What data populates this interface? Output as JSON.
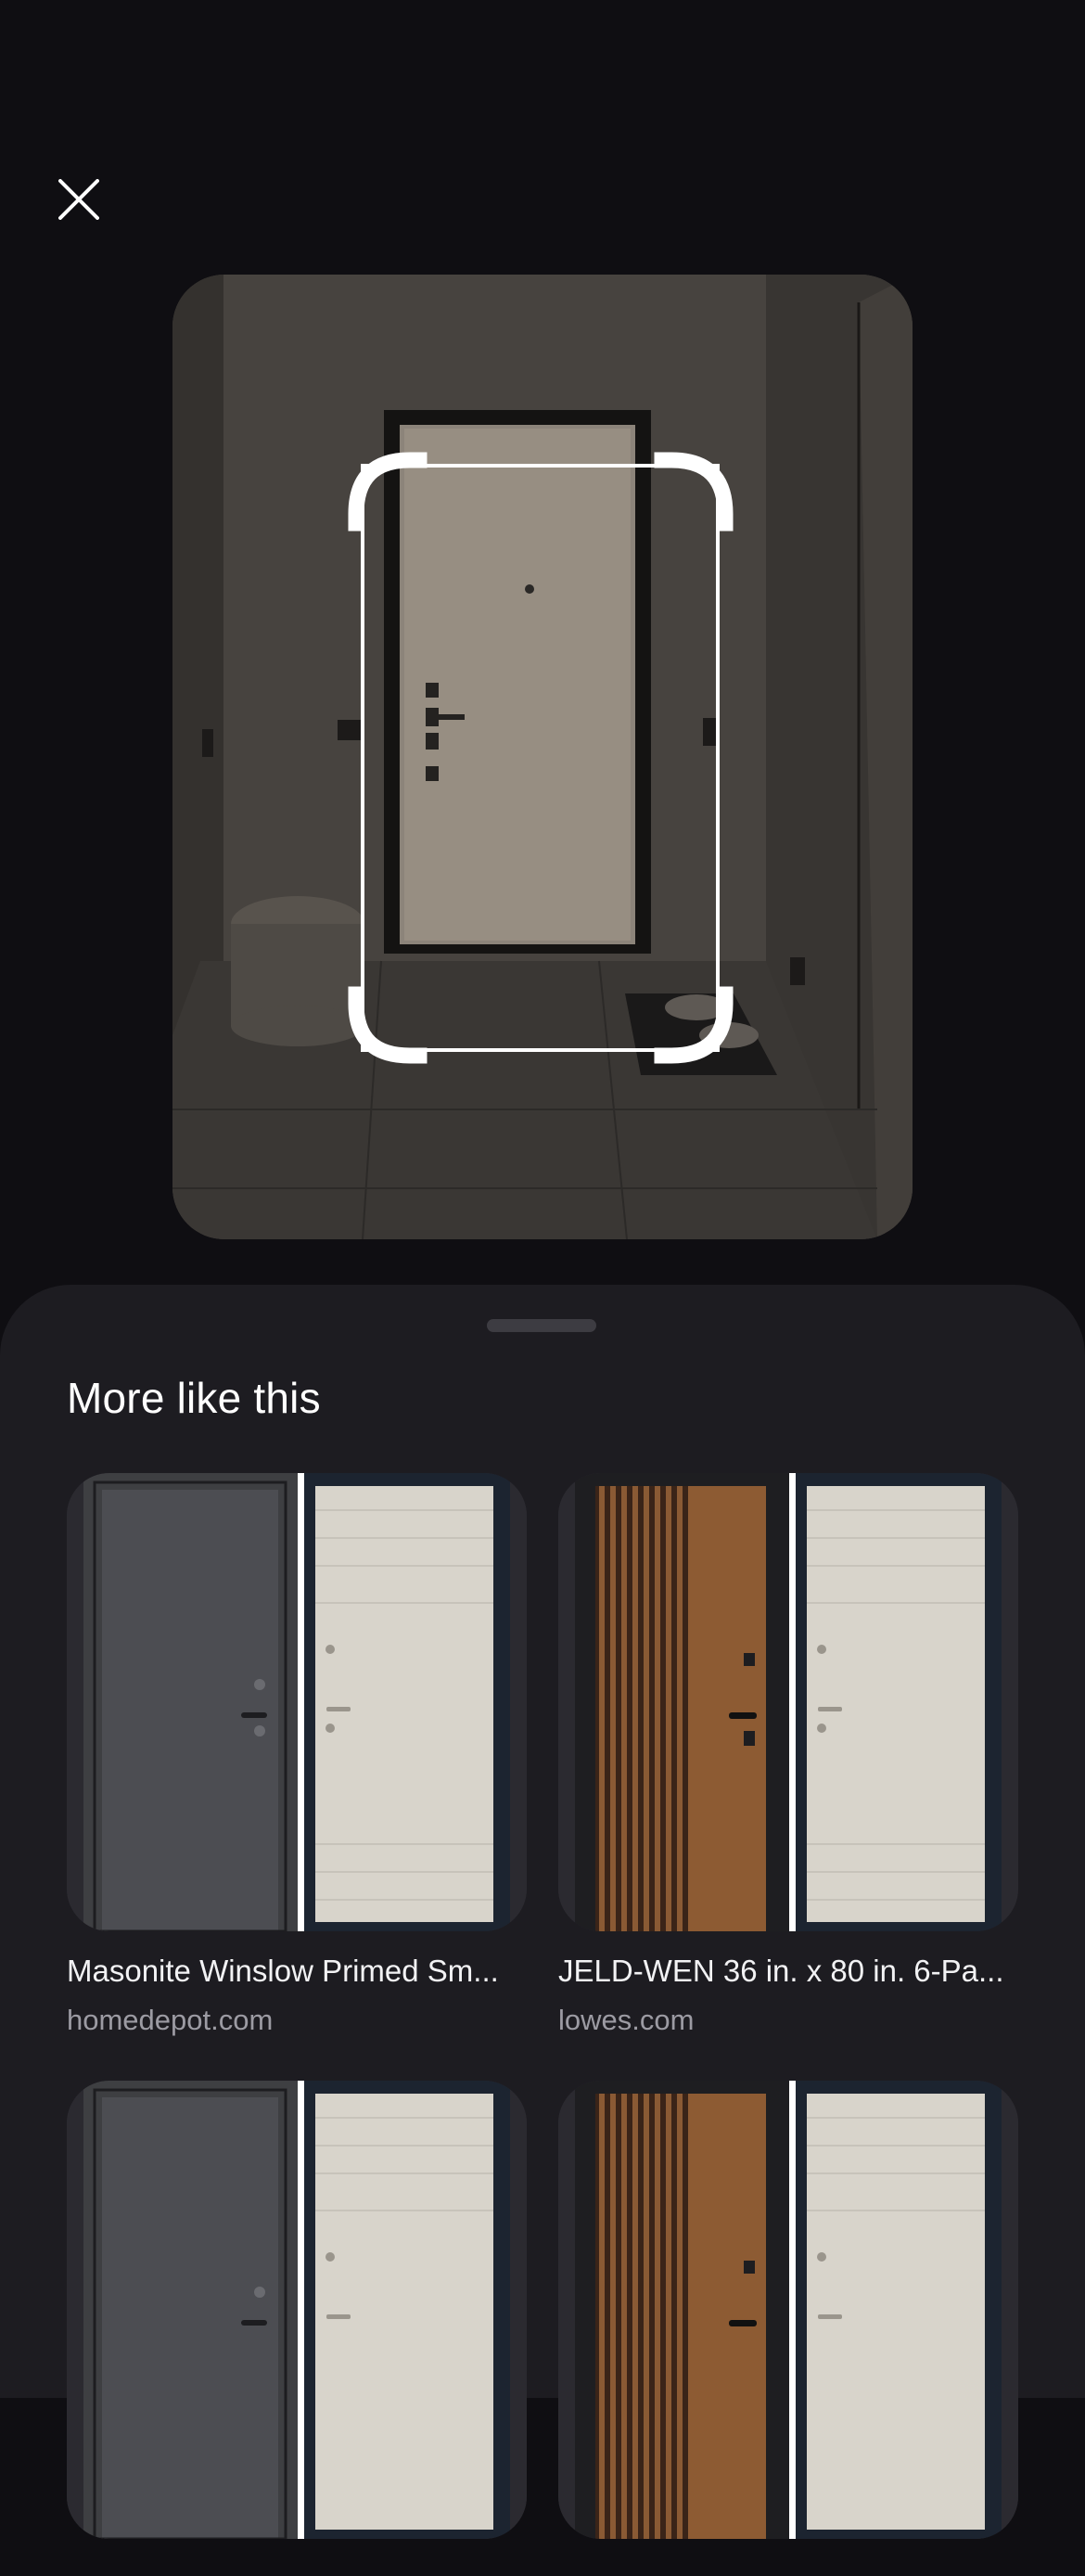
{
  "header": {
    "close_icon": "close-icon"
  },
  "selection": {
    "crop_icon": "crop-corners-icon"
  },
  "sheet": {
    "title": "More like this",
    "results": [
      {
        "title": "Masonite Winslow Primed Sm...",
        "source": "homedepot.com",
        "image": "metal-gray-door-pair"
      },
      {
        "title": "JELD-WEN 36 in. x 80 in. 6-Pa...",
        "source": "lowes.com",
        "image": "wood-slat-door-pair"
      },
      {
        "title": "",
        "source": "",
        "image": "metal-gray-door-pair"
      },
      {
        "title": "",
        "source": "",
        "image": "wood-slat-door-pair"
      }
    ]
  },
  "colors": {
    "background": "#0f0e12",
    "sheet": "#1d1c21",
    "source_text": "#9c9ba3"
  }
}
